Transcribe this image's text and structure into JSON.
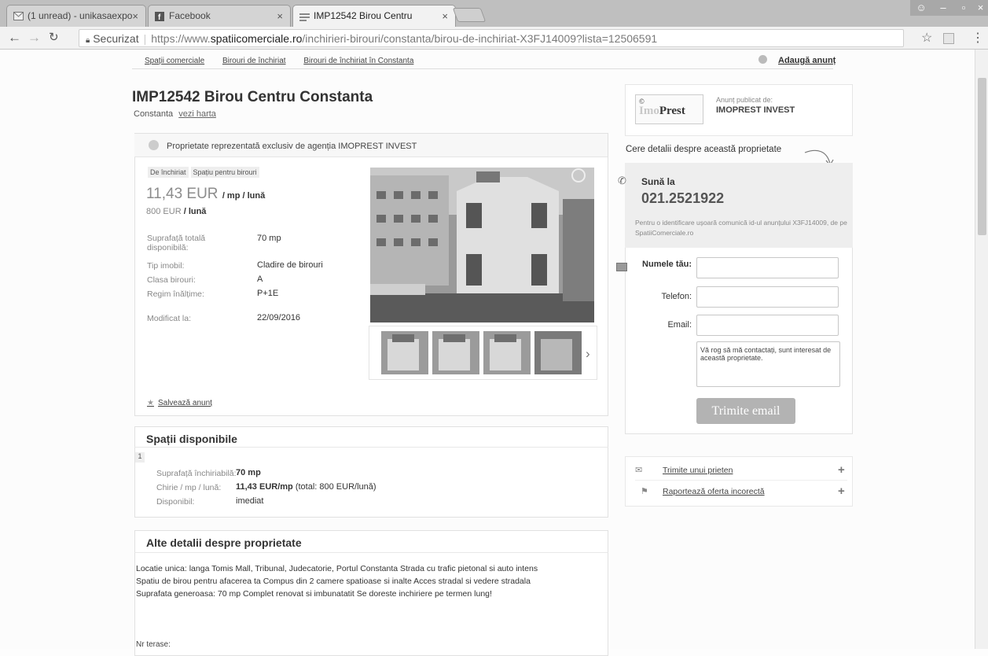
{
  "browser": {
    "tabs": [
      {
        "label": "(1 unread) - unikasaexpo"
      },
      {
        "label": "Facebook"
      },
      {
        "label": "IMP12542 Birou Centru"
      }
    ],
    "security_label": "Securizat",
    "url_prefix": "https://www.",
    "url_domain": "spatiicomerciale.ro",
    "url_path": "/inchirieri-birouri/constanta/birou-de-inchiriat-X3FJ14009?lista=12506591"
  },
  "breadcrumb": [
    "Spații comerciale",
    "Birouri de închiriat",
    "Birouri de închiriat în Constanta"
  ],
  "add_ad": "Adaugă anunț",
  "listing": {
    "title": "IMP12542 Birou Centru Constanta",
    "city": "Constanta",
    "map_link": "vezi harta",
    "exclusive_text": "Proprietate reprezentată exclusiv de agenția IMOPREST INVEST",
    "tags": [
      "De închiriat",
      "Spațiu pentru birouri"
    ],
    "price_value": "11,43 EUR",
    "price_unit": "/ mp / lună",
    "price_total": "800 EUR",
    "price_total_unit": "/ lună",
    "details": [
      {
        "label": "Suprafață totală disponibilă:",
        "value": "70 mp"
      },
      {
        "label": "Tip imobil:",
        "value": "Cladire de birouri"
      },
      {
        "label": "Clasa birouri:",
        "value": "A"
      },
      {
        "label": "Regim înălțime:",
        "value": "P+1E"
      },
      {
        "label": "Modificat la:",
        "value": "22/09/2016"
      }
    ],
    "save_label": "Salvează anunț"
  },
  "spaces": {
    "title": "Spații disponibile",
    "index": "1",
    "rows": [
      {
        "label": "Suprafață închiriabilă:",
        "value": "70 mp"
      },
      {
        "label": "Chirie / mp / lună:",
        "value": "11,43 EUR/mp",
        "extra": "(total: 800 EUR/lună)"
      },
      {
        "label": "Disponibil:",
        "value": "imediat"
      }
    ]
  },
  "other": {
    "title": "Alte detalii despre proprietate",
    "lines": [
      "Locatie unica: langa Tomis Mall, Tribunal, Judecatorie, Portul Constanta Strada cu trafic pietonal si auto intens",
      "Spatiu de birou pentru afacerea ta Compus din 2 camere spatioase si inalte Acces stradal si vedere stradala",
      "Suprafata generoasa: 70 mp Complet renovat si imbunatatit Se doreste inchiriere pe termen lung!"
    ],
    "terraces_label": "Nr terase:"
  },
  "agent": {
    "logo_c": "©",
    "logo_light": "Imo",
    "logo_dark": "Prest",
    "published_by": "Anunț publicat de:",
    "name": "IMOPREST INVEST"
  },
  "contact": {
    "ask": "Cere detalii despre această proprietate",
    "call_label": "Sună la",
    "phone": "021.2521922",
    "note": "Pentru o identificare ușoară comunică id-ul anunțului X3FJ14009, de pe SpatiiComerciale.ro",
    "name_label": "Numele tău:",
    "phone_label": "Telefon:",
    "email_label": "Email:",
    "message": "Vă rog să mă contactați, sunt interesat de această proprietate.",
    "send_label": "Trimite email"
  },
  "actions": {
    "send_friend": "Trimite unui prieten",
    "report": "Raportează oferta incorectă"
  }
}
